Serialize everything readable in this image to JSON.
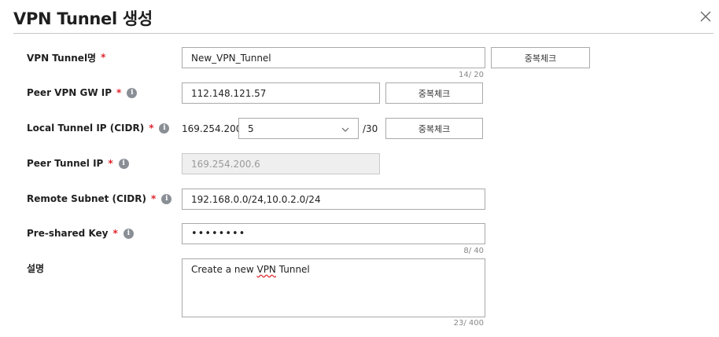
{
  "dialog": {
    "title": "VPN Tunnel 생성",
    "close_icon": "close-icon"
  },
  "required_mark": "*",
  "info_glyph": "i",
  "fields": {
    "tunnel_name": {
      "label": "VPN Tunnel명",
      "value": "New_VPN_Tunnel",
      "counter": "14/ 20",
      "button": "중복체크"
    },
    "peer_gw_ip": {
      "label": "Peer VPN GW IP",
      "value": "112.148.121.57",
      "button": "중복체크"
    },
    "local_tunnel_ip": {
      "label": "Local Tunnel IP (CIDR)",
      "prefix": "169.254.200.",
      "selected": "5",
      "suffix": "/30",
      "button": "중복체크"
    },
    "peer_tunnel_ip": {
      "label": "Peer Tunnel IP",
      "value": "169.254.200.6"
    },
    "remote_subnet": {
      "label": "Remote Subnet (CIDR)",
      "value": "192.168.0.0/24,10.0.2.0/24"
    },
    "preshared_key": {
      "label": "Pre-shared Key",
      "value": "••••••••",
      "counter": "8/ 40"
    },
    "description": {
      "label": "설명",
      "value_before": "Create a new ",
      "value_misspelled": "VPN",
      "value_after": " Tunnel",
      "counter": "23/ 400"
    }
  }
}
